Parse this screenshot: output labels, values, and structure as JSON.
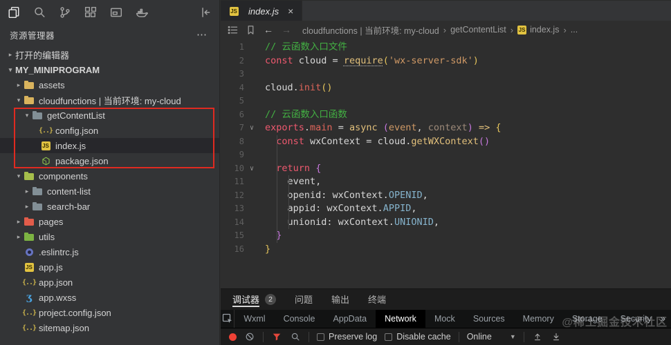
{
  "icons": {
    "more": "⋯",
    "close": "×",
    "back": "←",
    "forward": "→",
    "crumb_sep": "›",
    "tree_open": "▾",
    "tree_closed": "▸",
    "fold_open": "∨",
    "overflow": "»",
    "dropdown_caret": "▼"
  },
  "activity_bar": {
    "items": [
      "files",
      "search",
      "source-control",
      "extensions",
      "window",
      "docker"
    ],
    "right": "collapse-sidebar"
  },
  "sidebar": {
    "title": "资源管理器",
    "tree": [
      {
        "label": "打开的编辑器",
        "depth": 0,
        "expand": "closed"
      },
      {
        "label": "MY_MINIPROGRAM",
        "depth": 0,
        "expand": "open",
        "bold": true
      },
      {
        "label": "assets",
        "depth": 1,
        "expand": "closed",
        "icon": "folder-yellow"
      },
      {
        "label": "cloudfunctions | 当前环境: my-cloud",
        "depth": 1,
        "expand": "open",
        "icon": "folder-yellow"
      },
      {
        "label": "getContentList",
        "depth": 2,
        "expand": "open",
        "icon": "folder-gray"
      },
      {
        "label": "config.json",
        "depth": 3,
        "icon": "json"
      },
      {
        "label": "index.js",
        "depth": 3,
        "icon": "js",
        "selected": true
      },
      {
        "label": "package.json",
        "depth": 3,
        "icon": "npm"
      },
      {
        "label": "components",
        "depth": 1,
        "expand": "open",
        "icon": "folder-lime"
      },
      {
        "label": "content-list",
        "depth": 2,
        "expand": "closed",
        "icon": "folder-gray"
      },
      {
        "label": "search-bar",
        "depth": 2,
        "expand": "closed",
        "icon": "folder-gray"
      },
      {
        "label": "pages",
        "depth": 1,
        "expand": "closed",
        "icon": "folder-red"
      },
      {
        "label": "utils",
        "depth": 1,
        "expand": "closed",
        "icon": "folder-green"
      },
      {
        "label": ".eslintrc.js",
        "depth": 1,
        "icon": "eslint"
      },
      {
        "label": "app.js",
        "depth": 1,
        "icon": "js"
      },
      {
        "label": "app.json",
        "depth": 1,
        "icon": "json"
      },
      {
        "label": "app.wxss",
        "depth": 1,
        "icon": "wxss"
      },
      {
        "label": "project.config.json",
        "depth": 1,
        "icon": "json"
      },
      {
        "label": "sitemap.json",
        "depth": 1,
        "icon": "json"
      }
    ]
  },
  "editor": {
    "tab": {
      "label": "index.js",
      "icon": "js"
    },
    "breadcrumb": [
      {
        "label": "cloudfunctions | 当前环境: my-cloud"
      },
      {
        "label": "getContentList"
      },
      {
        "label": "index.js",
        "icon": "js"
      },
      {
        "label": "..."
      }
    ],
    "code": [
      {
        "num": 1,
        "fold": false,
        "tokens": [
          [
            "c",
            "// 云函数入口文件"
          ]
        ]
      },
      {
        "num": 2,
        "fold": false,
        "tokens": [
          [
            "k",
            "const"
          ],
          [
            "o",
            " cloud "
          ],
          [
            "o",
            "= "
          ],
          [
            "u",
            "require"
          ],
          [
            "p1",
            "("
          ],
          [
            "s",
            "'wx-server-sdk'"
          ],
          [
            "p1",
            ")"
          ]
        ]
      },
      {
        "num": 3,
        "fold": false,
        "tokens": []
      },
      {
        "num": 4,
        "fold": false,
        "tokens": [
          [
            "o",
            "cloud."
          ],
          [
            "m",
            "init"
          ],
          [
            "p1",
            "()"
          ]
        ]
      },
      {
        "num": 5,
        "fold": false,
        "tokens": []
      },
      {
        "num": 6,
        "fold": false,
        "tokens": [
          [
            "c",
            "// 云函数入口函数"
          ]
        ]
      },
      {
        "num": 7,
        "fold": true,
        "tokens": [
          [
            "k",
            "exports"
          ],
          [
            "o",
            "."
          ],
          [
            "m",
            "main"
          ],
          [
            "o",
            " = "
          ],
          [
            "f",
            "async"
          ],
          [
            "o",
            " "
          ],
          [
            "p2",
            "("
          ],
          [
            "pm",
            "event"
          ],
          [
            "o",
            ", "
          ],
          [
            "pd",
            "context"
          ],
          [
            "p2",
            ")"
          ],
          [
            "o",
            " "
          ],
          [
            "f",
            "=>"
          ],
          [
            "o",
            " "
          ],
          [
            "p1",
            "{"
          ]
        ]
      },
      {
        "num": 8,
        "fold": false,
        "tokens": [
          [
            "o",
            "  "
          ],
          [
            "k",
            "const"
          ],
          [
            "o",
            " wxContext = cloud."
          ],
          [
            "f",
            "getWXContext"
          ],
          [
            "p2",
            "()"
          ]
        ]
      },
      {
        "num": 9,
        "fold": false,
        "tokens": []
      },
      {
        "num": 10,
        "fold": true,
        "tokens": [
          [
            "o",
            "  "
          ],
          [
            "k",
            "return"
          ],
          [
            "o",
            " "
          ],
          [
            "p2",
            "{"
          ]
        ]
      },
      {
        "num": 11,
        "fold": false,
        "tokens": [
          [
            "o",
            "    event,"
          ]
        ]
      },
      {
        "num": 12,
        "fold": false,
        "tokens": [
          [
            "o",
            "    openid: wxContext."
          ],
          [
            "pr",
            "OPENID"
          ],
          [
            "o",
            ","
          ]
        ]
      },
      {
        "num": 13,
        "fold": false,
        "tokens": [
          [
            "o",
            "    appid: wxContext."
          ],
          [
            "pr",
            "APPID"
          ],
          [
            "o",
            ","
          ]
        ]
      },
      {
        "num": 14,
        "fold": false,
        "tokens": [
          [
            "o",
            "    unionid: wxContext."
          ],
          [
            "pr",
            "UNIONID"
          ],
          [
            "o",
            ","
          ]
        ]
      },
      {
        "num": 15,
        "fold": false,
        "tokens": [
          [
            "o",
            "  "
          ],
          [
            "p2",
            "}"
          ]
        ]
      },
      {
        "num": 16,
        "fold": false,
        "tokens": [
          [
            "p1",
            "}"
          ]
        ]
      }
    ]
  },
  "panel": {
    "tabs": [
      {
        "label": "调试器",
        "badge": "2",
        "active": true
      },
      {
        "label": "问题"
      },
      {
        "label": "输出"
      },
      {
        "label": "终端"
      }
    ],
    "devtools_tabs": [
      {
        "label": "Wxml"
      },
      {
        "label": "Console"
      },
      {
        "label": "AppData"
      },
      {
        "label": "Network",
        "active": true
      },
      {
        "label": "Mock"
      },
      {
        "label": "Sources"
      },
      {
        "label": "Memory"
      },
      {
        "label": "Storage"
      },
      {
        "label": "Security"
      }
    ],
    "overflow": "»",
    "toolbar": {
      "preserve_log": "Preserve log",
      "disable_cache": "Disable cache",
      "throttle": "Online"
    }
  },
  "watermark": "@稀土掘金技术社区",
  "colors": {
    "annotation_red": "#e02a20",
    "record_red": "#ef4135",
    "filter_red": "#e4473c",
    "active_tab_bg": "#000000",
    "comment_green": "#43b043"
  }
}
